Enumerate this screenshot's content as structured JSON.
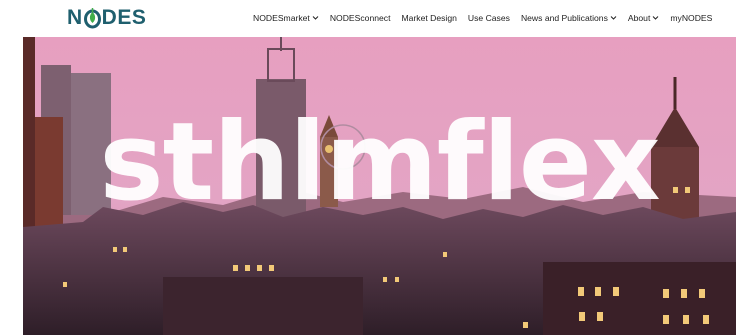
{
  "brand": {
    "name_prefix": "N",
    "name_suffix": "DES",
    "accent": "#1f5f6e",
    "leaf": "#3fae49"
  },
  "nav": {
    "items": [
      {
        "label": "NODESmarket",
        "dropdown": true
      },
      {
        "label": "NODESconnect",
        "dropdown": false
      },
      {
        "label": "Market Design",
        "dropdown": false
      },
      {
        "label": "Use Cases",
        "dropdown": false
      },
      {
        "label": "News and Publications",
        "dropdown": true
      },
      {
        "label": "About",
        "dropdown": true
      },
      {
        "label": "myNODES",
        "dropdown": false
      }
    ]
  },
  "hero": {
    "title": "sthlmflex",
    "sky_color": "#e8a6c2"
  }
}
